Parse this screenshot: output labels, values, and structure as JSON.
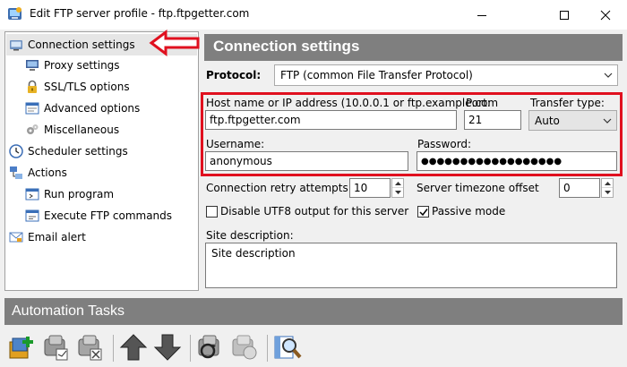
{
  "window": {
    "title": "Edit FTP server profile - ftp.ftpgetter.com",
    "minimize_icon": "minimize-icon",
    "maximize_icon": "maximize-icon",
    "close_icon": "close-icon"
  },
  "sidebar": {
    "items": [
      {
        "label": "Connection settings",
        "icon": "globe-icon",
        "selected": true
      },
      {
        "label": "Proxy settings",
        "icon": "monitor-icon"
      },
      {
        "label": "SSL/TLS options",
        "icon": "lock-icon"
      },
      {
        "label": "Advanced options",
        "icon": "window-icon"
      },
      {
        "label": "Miscellaneous",
        "icon": "gears-icon"
      },
      {
        "label": "Scheduler settings",
        "icon": "clock-icon"
      },
      {
        "label": "Actions",
        "icon": "actions-icon"
      },
      {
        "label": "Run program",
        "icon": "run-icon"
      },
      {
        "label": "Execute FTP commands",
        "icon": "terminal-icon"
      },
      {
        "label": "Email alert",
        "icon": "email-icon"
      }
    ]
  },
  "main": {
    "header": "Connection settings",
    "protocol_label": "Protocol:",
    "protocol_value": "FTP (common File Transfer Protocol)",
    "host_label": "Host name or IP address (10.0.0.1 or ftp.example.com",
    "host_value": "ftp.ftpgetter.com",
    "port_label": "Port:",
    "port_value": "21",
    "transfer_label": "Transfer type:",
    "transfer_value": "Auto",
    "username_label": "Username:",
    "username_value": "anonymous",
    "password_label": "Password:",
    "password_value": "●●●●●●●●●●●●●●●●●●",
    "retry_label": "Connection retry attempts",
    "retry_value": "10",
    "timezone_label": "Server timezone offset",
    "timezone_value": "0",
    "utf8_label": "Disable UTF8 output for this server",
    "utf8_checked": false,
    "passive_label": "Passive mode",
    "passive_checked": true,
    "site_desc_label": "Site description:",
    "site_desc_value": "Site description"
  },
  "automation": {
    "header": "Automation Tasks",
    "tools": [
      "add-task-icon",
      "edit-task-icon",
      "delete-task-icon",
      "move-up-icon",
      "move-down-icon",
      "run-task-icon",
      "stop-task-icon",
      "search-log-icon"
    ]
  },
  "colors": {
    "header_bg": "#7f7f7f",
    "annotation_red": "#e0101f"
  }
}
